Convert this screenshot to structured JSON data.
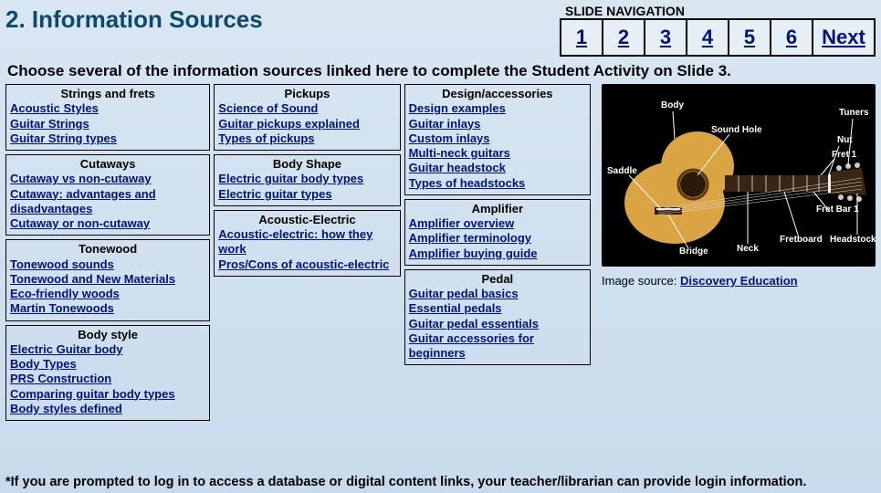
{
  "title": "2. Information Sources",
  "nav": {
    "label": "SLIDE NAVIGATION",
    "items": [
      "1",
      "2",
      "3",
      "4",
      "5",
      "6",
      "Next"
    ]
  },
  "instruction": "Choose several of the information sources linked here to complete the Student Activity on Slide 3.",
  "columns": [
    [
      {
        "title": "Strings and frets",
        "links": [
          "Acoustic Styles",
          "Guitar Strings",
          "Guitar String types"
        ]
      },
      {
        "title": "Cutaways",
        "links": [
          "Cutaway vs non-cutaway",
          "Cutaway: advantages and disadvantages",
          "Cutaway or non-cutaway"
        ]
      },
      {
        "title": "Tonewood",
        "links": [
          "Tonewood sounds",
          "Tonewood and New Materials",
          "Eco-friendly woods",
          "Martin Tonewoods"
        ]
      },
      {
        "title": "Body style",
        "links": [
          "Electric Guitar body",
          "Body Types",
          "PRS Construction",
          "Comparing guitar body types",
          "Body styles defined"
        ]
      }
    ],
    [
      {
        "title": "Pickups",
        "links": [
          "Science of Sound",
          "Guitar pickups explained",
          "Types of pickups"
        ]
      },
      {
        "title": "Body Shape",
        "links": [
          "Electric guitar body types",
          "Electric guitar types"
        ]
      },
      {
        "title": "Acoustic-Electric",
        "links": [
          "Acoustic-electric: how they work",
          "Pros/Cons of acoustic-electric"
        ]
      }
    ],
    [
      {
        "title": "Design/accessories",
        "links": [
          "Design examples",
          "Guitar inlays",
          "Custom inlays",
          "Multi-neck guitars",
          "Guitar headstock",
          "Types of headstocks"
        ]
      },
      {
        "title": "Amplifier",
        "links": [
          "Amplifier overview",
          "Amplifier terminology",
          "Amplifier buying guide"
        ]
      },
      {
        "title": "Pedal",
        "links": [
          "Guitar pedal basics",
          "Essential pedals",
          "Guitar pedal essentials",
          "Guitar accessories for beginners"
        ]
      }
    ]
  ],
  "image": {
    "caption_prefix": "Image source: ",
    "caption_link": "Discovery Education",
    "labels": [
      "Body",
      "Sound Hole",
      "Tuners",
      "Nut",
      "Fret 1",
      "Saddle",
      "Fret Bar 1",
      "Headstock",
      "Fretboard",
      "Neck",
      "Bridge"
    ]
  },
  "footnote": "*If you are prompted to log in to access a database or digital content links, your teacher/librarian can provide login information."
}
